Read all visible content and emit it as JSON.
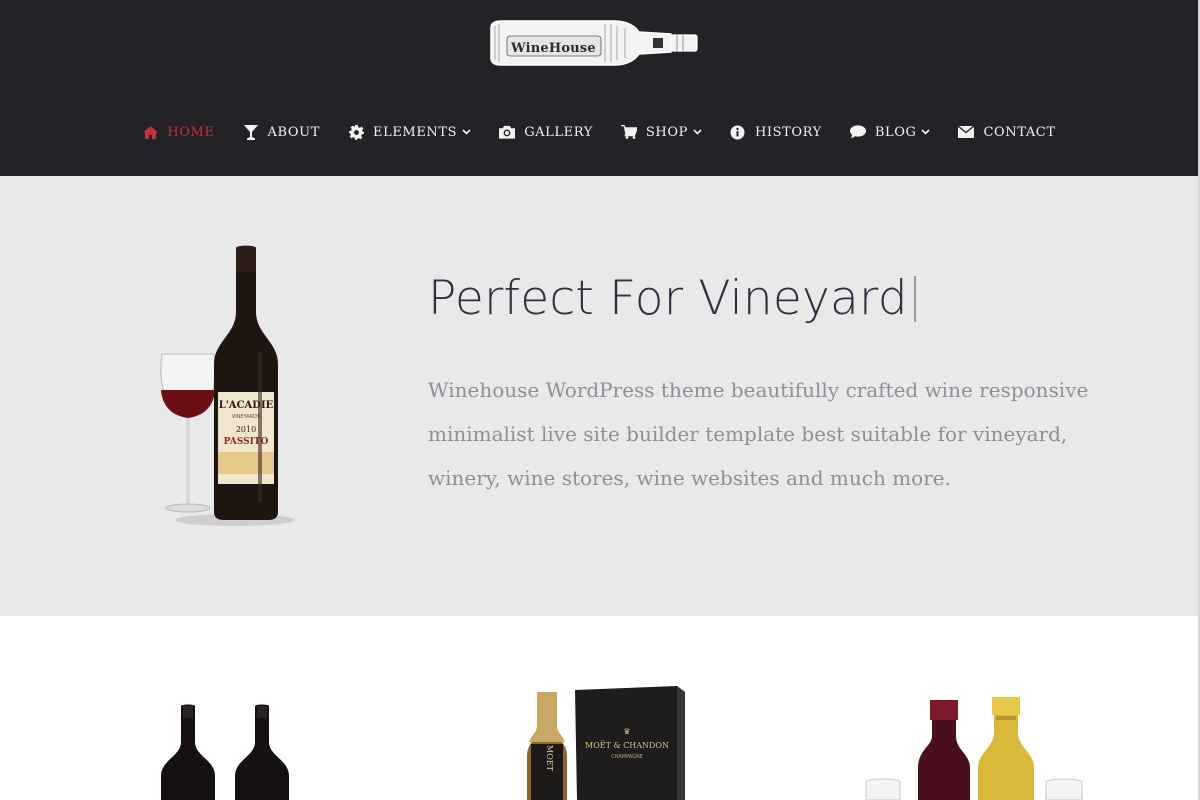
{
  "brand": {
    "logo_text": "WineHouse"
  },
  "nav": {
    "items": [
      {
        "label": "HOME",
        "icon": "home-icon",
        "active": true
      },
      {
        "label": "ABOUT",
        "icon": "cocktail-glass-icon"
      },
      {
        "label": "ELEMENTS",
        "icon": "gear-icon",
        "dropdown": true
      },
      {
        "label": "GALLERY",
        "icon": "camera-icon"
      },
      {
        "label": "SHOP",
        "icon": "cart-icon",
        "dropdown": true
      },
      {
        "label": "HISTORY",
        "icon": "info-icon"
      },
      {
        "label": "BLOG",
        "icon": "comment-icon",
        "dropdown": true
      },
      {
        "label": "CONTACT",
        "icon": "envelope-icon"
      }
    ]
  },
  "hero": {
    "title": "Perfect For Vineyard",
    "text": "Winehouse WordPress theme beautifully crafted wine responsive minimalist live site builder template best suitable for vineyard, winery, wine stores, wine websites and much more.",
    "bottle_label": {
      "brand": "L'ACADIE",
      "sub": "VINEYARDS",
      "year": "2010",
      "name": "PASSITO"
    }
  },
  "products": {
    "items": [
      {
        "name": "two-red-wine-bottles"
      },
      {
        "name": "moet-chandon-champagne",
        "box_brand": "MOËT & CHANDON",
        "box_sub": "CHAMPAGNE",
        "bottle_label": "MOET"
      },
      {
        "name": "red-and-white-wine-bottles"
      }
    ]
  },
  "colors": {
    "header_bg": "#222227",
    "nav_active": "#c0323c",
    "hero_bg": "#e9e9ea",
    "title": "#2c3040",
    "body_text": "#8d8f98"
  }
}
